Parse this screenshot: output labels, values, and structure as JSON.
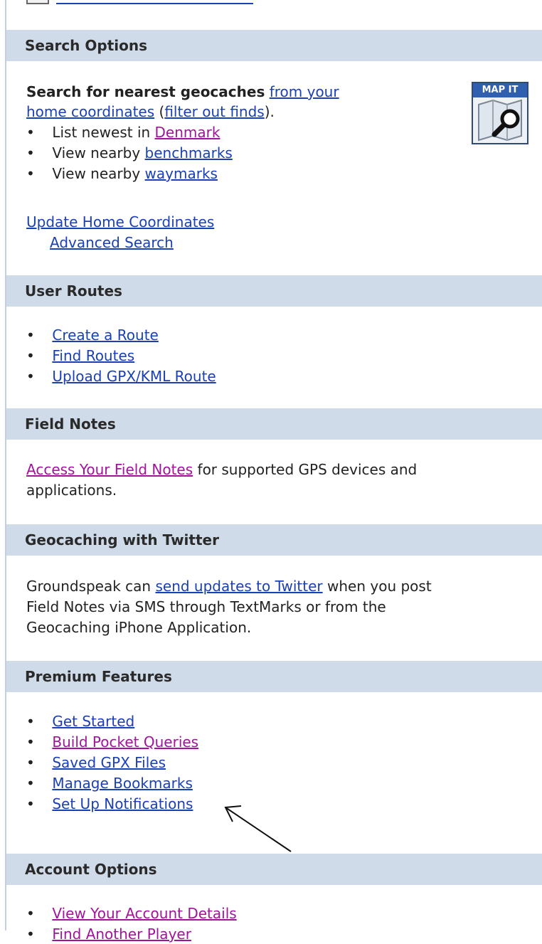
{
  "sections": {
    "search": {
      "header": "Search Options",
      "intro_bold": "Search for nearest geocaches",
      "link_home_coords": "from your",
      "link_home_coords2": "home coordinates",
      "paren_open": " (",
      "link_filter": "filter out finds",
      "paren_close": ").",
      "bullet1_prefix": "List newest in ",
      "bullet1_link": "Denmark",
      "bullet2_prefix": "View nearby ",
      "bullet2_link": "benchmarks",
      "bullet3_prefix": "View nearby ",
      "bullet3_link": "waymarks",
      "link_update": "Update Home Coordinates",
      "link_advanced": "Advanced Search",
      "mapit_label": "MAP IT"
    },
    "routes": {
      "header": "User Routes",
      "items": [
        "Create a Route",
        "Find Routes",
        "Upload GPX/KML Route"
      ]
    },
    "fieldnotes": {
      "header": "Field Notes",
      "link": "Access Your Field Notes",
      "text1": " for supported GPS devices and",
      "text2": "applications."
    },
    "twitter": {
      "header": "Geocaching with Twitter",
      "line1_prefix": "Groundspeak can ",
      "line1_link": "send updates to Twitter",
      "line1_suffix": " when you post",
      "line2": "Field Notes via SMS through TextMarks or from the",
      "line3": "Geocaching iPhone Application."
    },
    "premium": {
      "header": "Premium Features",
      "items": [
        "Get Started",
        "Build Pocket Queries",
        "Saved GPX Files",
        "Manage Bookmarks",
        "Set Up Notifications"
      ]
    },
    "account": {
      "header": "Account Options",
      "items": [
        "View Your Account Details",
        "Find Another Player"
      ]
    }
  },
  "colors": {
    "header_bg": "#cfdbe8",
    "link": "#1b3fb5",
    "visited": "#a0149b"
  }
}
